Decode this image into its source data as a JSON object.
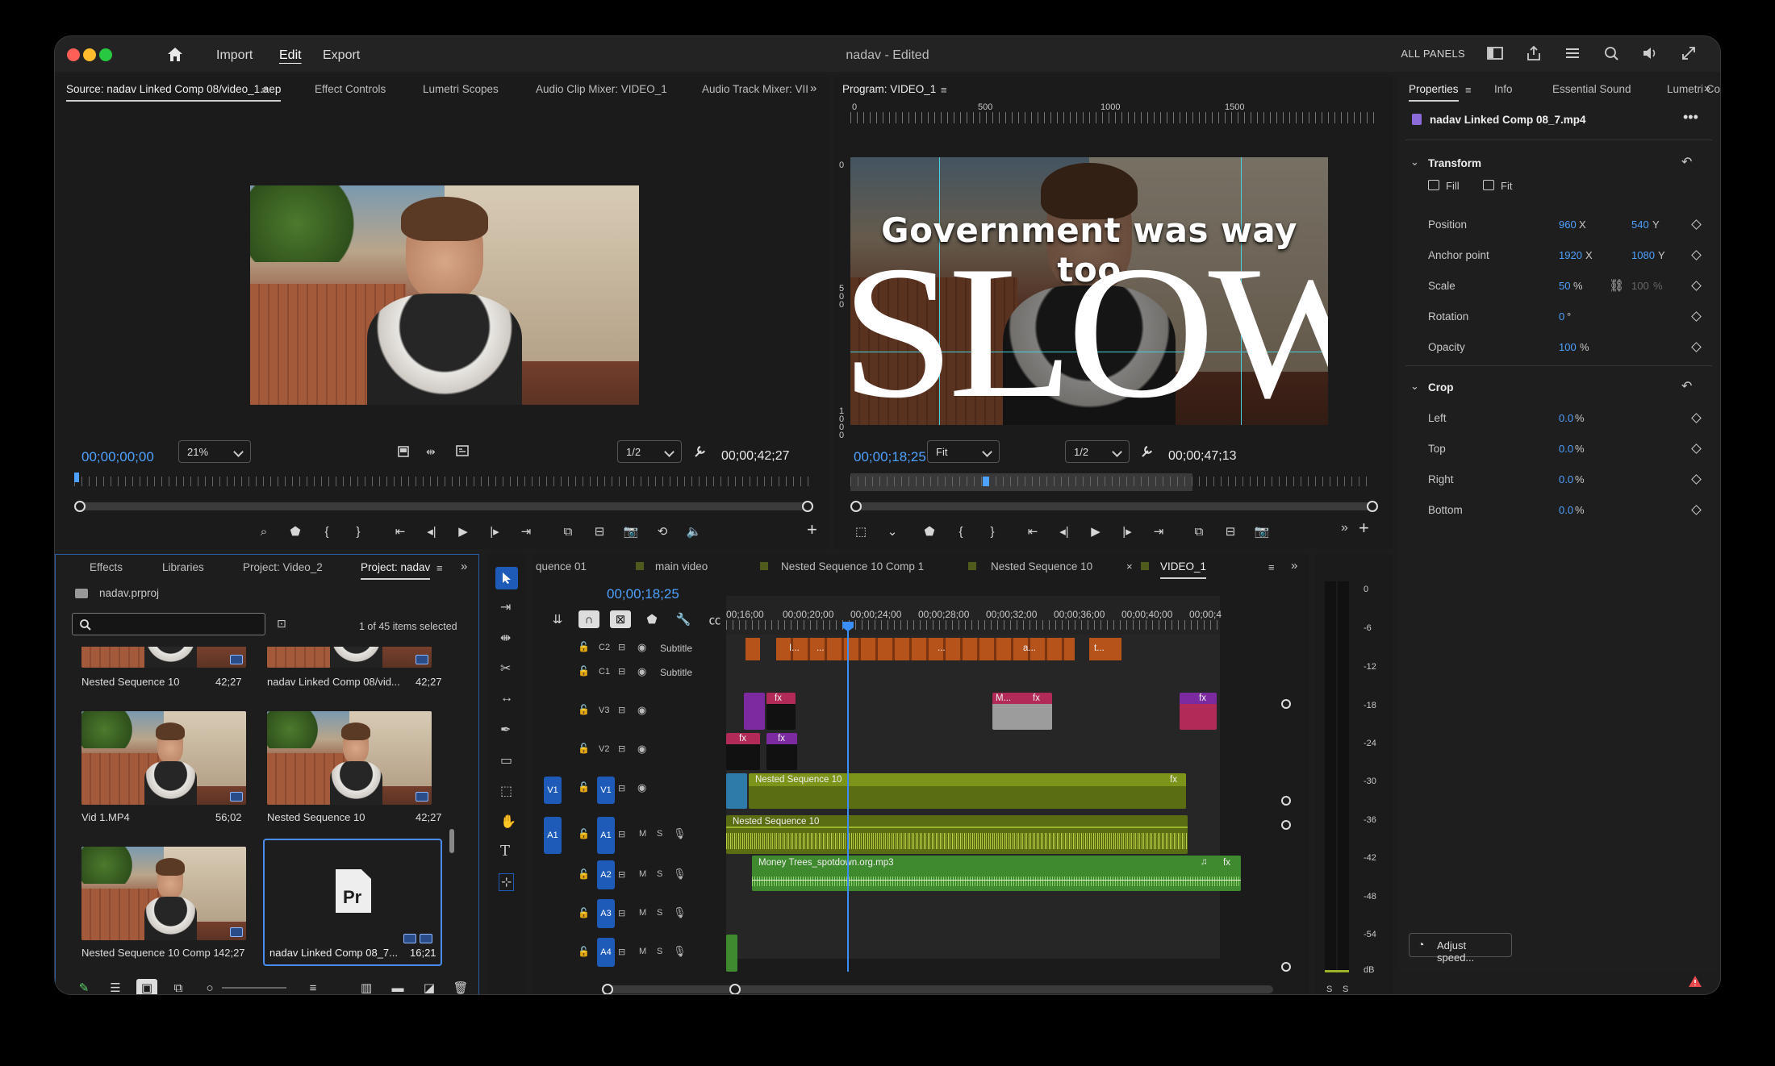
{
  "window": {
    "title": "nadav - Edited",
    "nav": [
      "Import",
      "Edit",
      "Export"
    ],
    "all_panels": "ALL PANELS"
  },
  "source_panel": {
    "tabs": [
      "Source: nadav Linked Comp 08/video_1.aep",
      "Effect Controls",
      "Lumetri Scopes",
      "Audio Clip Mixer: VIDEO_1",
      "Audio Track Mixer: VII"
    ],
    "timecode_in": "00;00;00;00",
    "zoom": "21%",
    "resolution": "1/2",
    "duration": "00;00;42;27"
  },
  "program_panel": {
    "tab": "Program: VIDEO_1",
    "ruler_labels": [
      "0",
      "500",
      "1000",
      "1500"
    ],
    "vruler_labels": [
      "0",
      "500",
      "1000"
    ],
    "caption_line1": "Government was way too",
    "caption_big": "SLOW",
    "timecode": "00;00;18;25",
    "fit": "Fit",
    "resolution": "1/2",
    "duration": "00;00;47;13"
  },
  "properties": {
    "tabs": [
      "Properties",
      "Info",
      "Essential Sound",
      "Lumetri Color"
    ],
    "clip_name": "nadav Linked Comp 08_7.mp4",
    "transform_title": "Transform",
    "fill": "Fill",
    "fit": "Fit",
    "rows": [
      {
        "label": "Position",
        "v1": "960",
        "u1": "X",
        "v2": "540",
        "u2": "Y"
      },
      {
        "label": "Anchor point",
        "v1": "1920",
        "u1": "X",
        "v2": "1080",
        "u2": "Y"
      },
      {
        "label": "Scale",
        "v1": "50",
        "u1": "%",
        "v2": "100",
        "u2": "%"
      },
      {
        "label": "Rotation",
        "v1": "0",
        "u1": "°",
        "v2": "",
        "u2": ""
      },
      {
        "label": "Opacity",
        "v1": "100",
        "u1": "%",
        "v2": "",
        "u2": ""
      }
    ],
    "crop_title": "Crop",
    "crop_rows": [
      {
        "label": "Left",
        "v": "0.0",
        "u": "%"
      },
      {
        "label": "Top",
        "v": "0.0",
        "u": "%"
      },
      {
        "label": "Right",
        "v": "0.0",
        "u": "%"
      },
      {
        "label": "Bottom",
        "v": "0.0",
        "u": "%"
      }
    ],
    "adjust_speed": "Adjust speed..."
  },
  "project_panel": {
    "tabs": [
      "Effects",
      "Libraries",
      "Project: Video_2",
      "Project: nadav"
    ],
    "project_file": "nadav.prproj",
    "search_placeholder": "",
    "selection": "1 of 45 items selected",
    "items": [
      {
        "name": "Nested Sequence 10",
        "dur": "42;27"
      },
      {
        "name": "nadav Linked Comp 08/vid...",
        "dur": "42;27"
      },
      {
        "name": "Vid 1.MP4",
        "dur": "56;02"
      },
      {
        "name": "Nested Sequence 10",
        "dur": "42;27"
      },
      {
        "name": "Nested Sequence 10 Comp 1",
        "dur": "42;27"
      },
      {
        "name": "nadav Linked Comp 08_7...",
        "dur": "16;21"
      }
    ],
    "pr_icon": "Pr"
  },
  "timeline": {
    "tabs": [
      "quence 01",
      "main video",
      "Nested Sequence 10 Comp 1",
      "Nested Sequence 10",
      "VIDEO_1"
    ],
    "timecode": "00;00;18;25",
    "ruler": [
      "00;16;00",
      "00;00;20;00",
      "00;00;24;00",
      "00;00;28;00",
      "00;00;32;00",
      "00;00;36;00",
      "00;00;40;00",
      "00;00;4"
    ],
    "caption_tracks": [
      {
        "name": "C2",
        "label": "Subtitle"
      },
      {
        "name": "C1",
        "label": "Subtitle"
      }
    ],
    "video_tracks": [
      "V3",
      "V2",
      "V1"
    ],
    "audio_tracks": [
      "A1",
      "A2",
      "A3",
      "A4"
    ],
    "clip_v1": "Nested Sequence 10",
    "clip_a1": "Nested Sequence 10",
    "clip_a2": "Money Trees_spotdown.org.mp3",
    "clip_v3_label": "M...",
    "caption_chips": [
      "I...",
      "...",
      "...",
      "a...",
      "t..."
    ],
    "fx": "fx",
    "m": "M",
    "s": "S"
  },
  "meter": {
    "labels": [
      "0",
      "-6",
      "-12",
      "-18",
      "-24",
      "-30",
      "-36",
      "-42",
      "-48",
      "-54",
      "dB"
    ],
    "bottom": [
      "S",
      "S"
    ]
  }
}
